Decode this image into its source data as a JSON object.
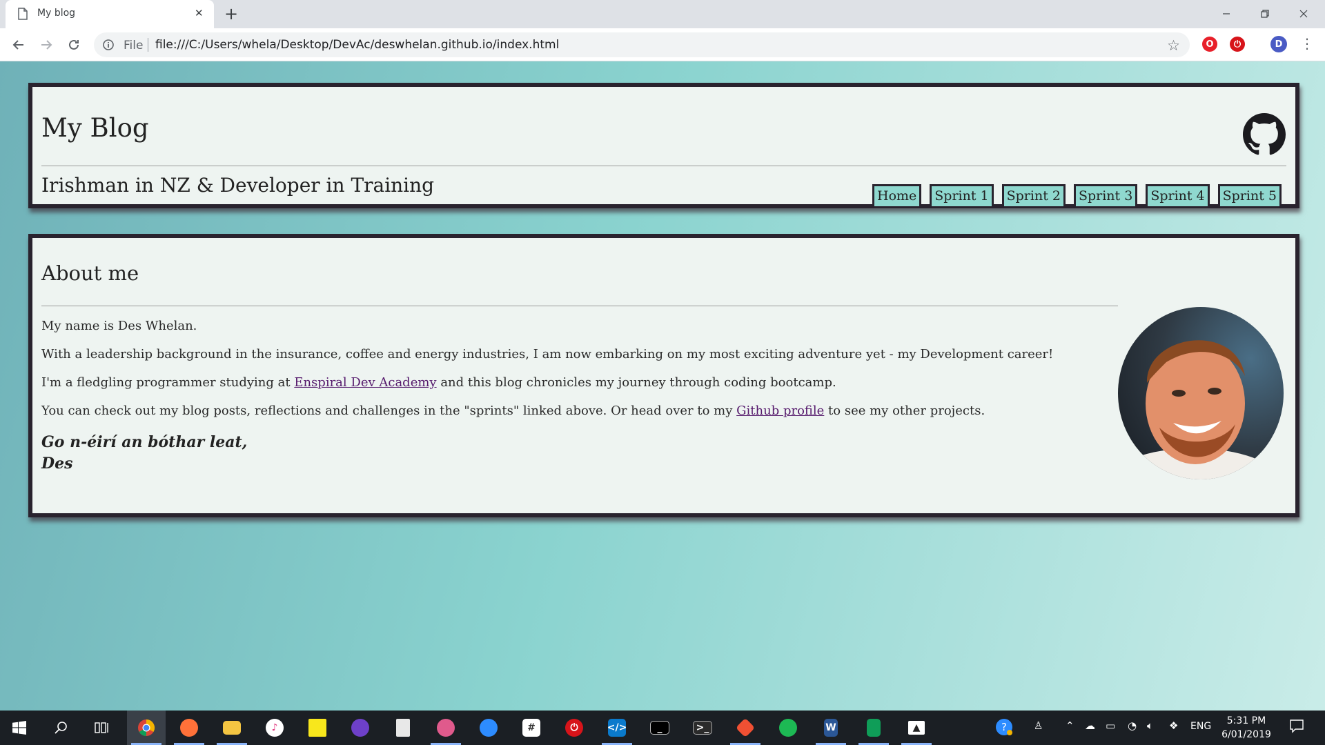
{
  "browser": {
    "tab_title": "My blog",
    "url_scheme": "File",
    "url": "file:///C:/Users/whela/Desktop/DevAc/deswhelan.github.io/index.html",
    "profile_initial": "D"
  },
  "header": {
    "title": "My Blog",
    "tagline": "Irishman in NZ & Developer in Training",
    "nav": [
      "Home",
      "Sprint 1",
      "Sprint 2",
      "Sprint 3",
      "Sprint 4",
      "Sprint 5"
    ]
  },
  "about": {
    "title": "About me",
    "p1": "My name is Des Whelan.",
    "p2": "With a leadership background in the insurance, coffee and energy industries, I am now embarking on my most exciting adventure yet - my Development career!",
    "p3_before": "I'm a fledgling programmer studying at ",
    "p3_link": "Enspiral Dev Academy",
    "p3_after": " and this blog chronicles my journey through coding bootcamp.",
    "p4_before": "You can check out my blog posts, reflections and challenges in the \"sprints\" linked above. Or head over to my ",
    "p4_link": "Github profile",
    "p4_after": " to see my other projects.",
    "signoff_line1": "Go n-éirí an bóthar leat,",
    "signoff_line2": "Des"
  },
  "taskbar": {
    "apps": [
      "chrome",
      "firefox",
      "file-explorer",
      "itunes",
      "sticky-notes",
      "github-desktop",
      "notepad",
      "paint",
      "zoom",
      "slack",
      "power",
      "vscode",
      "cmd",
      "terminal",
      "git",
      "spotify",
      "word",
      "sheets",
      "photos"
    ],
    "language": "ENG",
    "time": "5:31 PM",
    "date": "6/01/2019"
  },
  "colors": {
    "panel_bg": "#eef4f1",
    "panel_border": "#29232e",
    "nav_button_bg": "#8fd8cf",
    "link": "#55196c"
  }
}
